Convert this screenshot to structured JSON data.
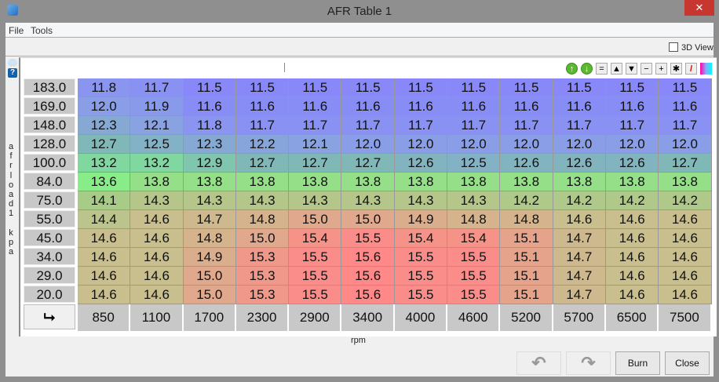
{
  "window": {
    "title": "AFR Table 1",
    "close": "✕"
  },
  "menu": [
    "File",
    "Tools"
  ],
  "toolbar": {
    "view3d": "3D View",
    "tools": [
      "↑",
      "↓",
      "=",
      "▲",
      "▼",
      "−",
      "+",
      "✱",
      "/",
      ""
    ]
  },
  "side": {
    "help": "?",
    "axis_label": "afrload1 kpa"
  },
  "table": {
    "y_axis": [
      "183.0",
      "169.0",
      "148.0",
      "128.0",
      "100.0",
      "84.0",
      "75.0",
      "55.0",
      "45.0",
      "34.0",
      "29.0",
      "20.0"
    ],
    "x_axis": [
      "850",
      "1100",
      "1700",
      "2300",
      "2900",
      "3400",
      "4000",
      "4600",
      "5200",
      "5700",
      "6500",
      "7500"
    ],
    "x_label": "rpm",
    "corner": "⮡",
    "rows": [
      [
        "11.8",
        "11.7",
        "11.5",
        "11.5",
        "11.5",
        "11.5",
        "11.5",
        "11.5",
        "11.5",
        "11.5",
        "11.5",
        "11.5"
      ],
      [
        "12.0",
        "11.9",
        "11.6",
        "11.6",
        "11.6",
        "11.6",
        "11.6",
        "11.6",
        "11.6",
        "11.6",
        "11.6",
        "11.6"
      ],
      [
        "12.3",
        "12.1",
        "11.8",
        "11.7",
        "11.7",
        "11.7",
        "11.7",
        "11.7",
        "11.7",
        "11.7",
        "11.7",
        "11.7"
      ],
      [
        "12.7",
        "12.5",
        "12.3",
        "12.2",
        "12.1",
        "12.0",
        "12.0",
        "12.0",
        "12.0",
        "12.0",
        "12.0",
        "12.0"
      ],
      [
        "13.2",
        "13.2",
        "12.9",
        "12.7",
        "12.7",
        "12.7",
        "12.6",
        "12.5",
        "12.6",
        "12.6",
        "12.6",
        "12.7"
      ],
      [
        "13.6",
        "13.8",
        "13.8",
        "13.8",
        "13.8",
        "13.8",
        "13.8",
        "13.8",
        "13.8",
        "13.8",
        "13.8",
        "13.8"
      ],
      [
        "14.1",
        "14.3",
        "14.3",
        "14.3",
        "14.3",
        "14.3",
        "14.3",
        "14.3",
        "14.2",
        "14.2",
        "14.2",
        "14.2"
      ],
      [
        "14.4",
        "14.6",
        "14.7",
        "14.8",
        "15.0",
        "15.0",
        "14.9",
        "14.8",
        "14.8",
        "14.6",
        "14.6",
        "14.6"
      ],
      [
        "14.6",
        "14.6",
        "14.8",
        "15.0",
        "15.4",
        "15.5",
        "15.4",
        "15.4",
        "15.1",
        "14.7",
        "14.6",
        "14.6"
      ],
      [
        "14.6",
        "14.6",
        "14.9",
        "15.3",
        "15.5",
        "15.6",
        "15.5",
        "15.5",
        "15.1",
        "14.7",
        "14.6",
        "14.6"
      ],
      [
        "14.6",
        "14.6",
        "15.0",
        "15.3",
        "15.5",
        "15.6",
        "15.5",
        "15.5",
        "15.1",
        "14.7",
        "14.6",
        "14.6"
      ],
      [
        "14.6",
        "14.6",
        "15.0",
        "15.3",
        "15.5",
        "15.6",
        "15.5",
        "15.5",
        "15.1",
        "14.7",
        "14.6",
        "14.6"
      ]
    ]
  },
  "buttons": {
    "undo": "↶",
    "redo": "↷",
    "burn": "Burn",
    "close": "Close"
  }
}
